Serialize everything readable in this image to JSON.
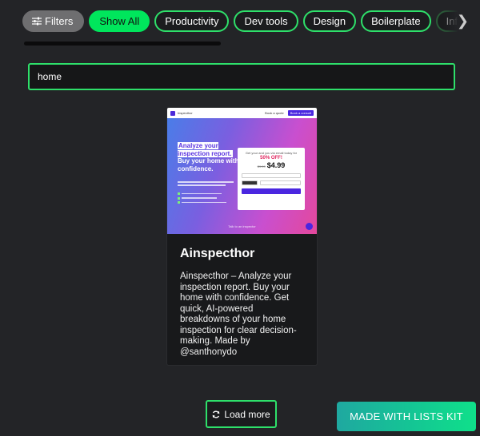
{
  "filter_bar": {
    "filters_label": "Filters",
    "filters_icon": "sliders-icon",
    "categories": [
      "Show All",
      "Productivity",
      "Dev tools",
      "Design",
      "Boilerplate",
      "Info directory"
    ],
    "active_category": "Show All",
    "next_icon": "chevron-right-icon"
  },
  "search": {
    "value": "home",
    "placeholder": ""
  },
  "results": [
    {
      "title": "Ainspecthor",
      "description": "Ainspecthor – Analyze your inspection report. Buy your home with confidence. Get quick, AI-powered breakdowns of your home inspection for clear decision-making. Made by @santhonydo",
      "thumbnail": {
        "brand": "Inspecthor",
        "nav_link": "Book a quote",
        "nav_cta": "Book a consult",
        "headline_highlight": "Analyze your inspection report.",
        "headline_rest": "Buy your home with confidence.",
        "box_title": "Get your and you via email today for",
        "box_offer": "50% OFF!",
        "box_old_price": "$9.99",
        "box_price": "$4.99",
        "footer": "Talk to an inspector"
      }
    }
  ],
  "load_more": {
    "label": "Load more",
    "icon": "refresh-icon"
  },
  "made_with": {
    "label": "MADE WITH LISTS KIT"
  },
  "colors": {
    "background": "#232427",
    "accent_green": "#2ee06a",
    "active_pill": "#00e65c"
  }
}
